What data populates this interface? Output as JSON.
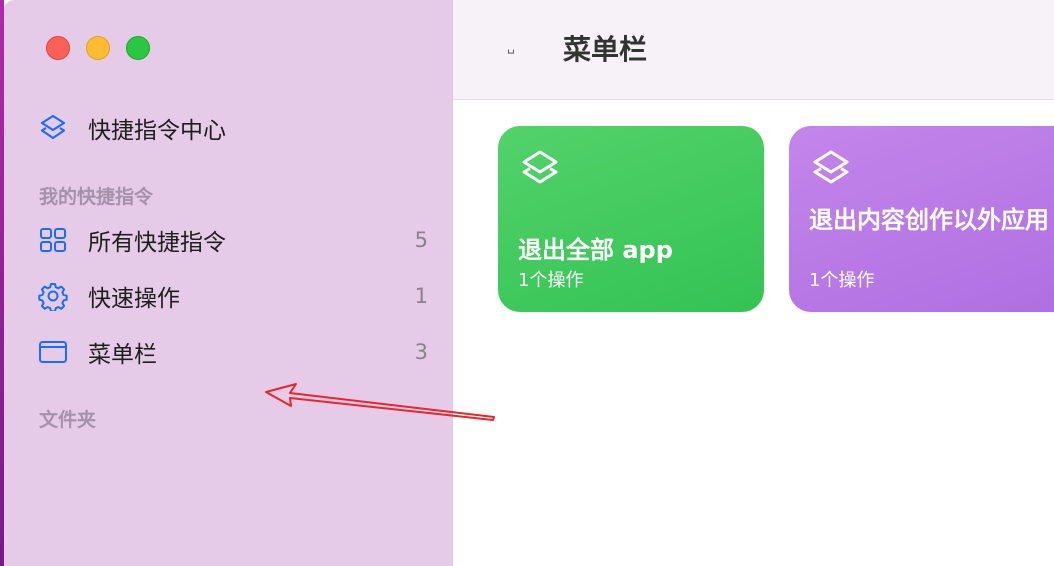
{
  "window": {
    "traffic_lights": [
      "close",
      "minimize",
      "zoom"
    ]
  },
  "sidebar": {
    "gallery_item": {
      "label": "快捷指令中心",
      "icon": "layers-icon"
    },
    "sections": {
      "my_shortcuts": "我的快捷指令",
      "folders": "文件夹"
    },
    "items": [
      {
        "label": "所有快捷指令",
        "count": "5",
        "icon": "grid-icon"
      },
      {
        "label": "快速操作",
        "count": "1",
        "icon": "gear-icon"
      },
      {
        "label": "菜单栏",
        "count": "3",
        "icon": "window-icon"
      }
    ]
  },
  "toolbar": {
    "toggle_glyph": "␣",
    "title": "菜单栏"
  },
  "cards": [
    {
      "title": "退出全部 app",
      "subtitle": "1个操作",
      "color": "#34c759",
      "icon": "layers-icon"
    },
    {
      "title": "退出内容创作以外应用",
      "subtitle": "1个操作",
      "color": "#b36ee4",
      "icon": "layers-icon"
    }
  ],
  "colors": {
    "sidebar_bg": "#e6cbe8",
    "accent_blue": "#1a6ef5",
    "annotation_arrow": "#e8262b"
  }
}
